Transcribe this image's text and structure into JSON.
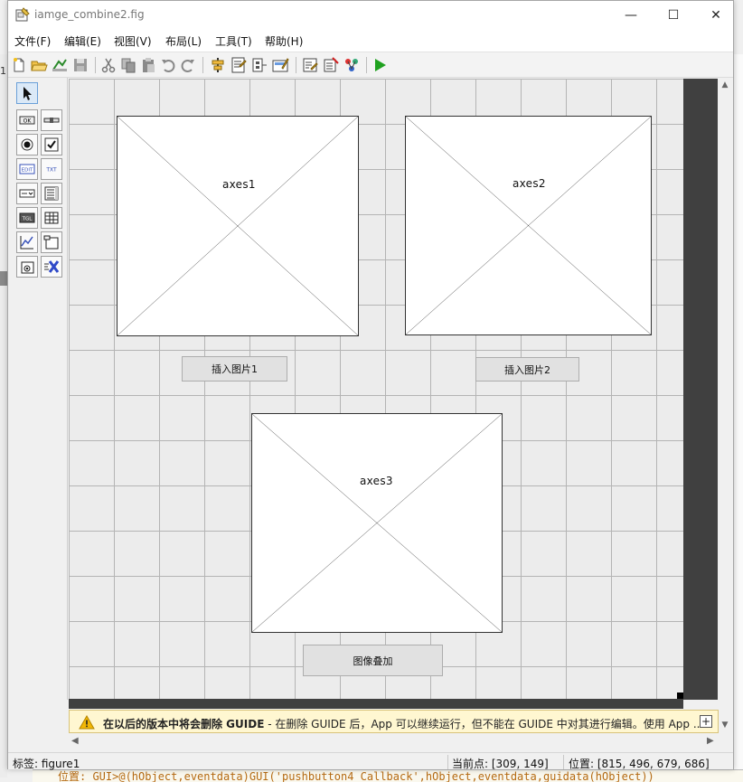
{
  "window": {
    "title": "iamge_combine2.fig",
    "minimize_symbol": "—",
    "maximize_symbol": "☐",
    "close_symbol": "✕"
  },
  "menu": [
    {
      "label": "文件(F)"
    },
    {
      "label": "编辑(E)"
    },
    {
      "label": "视图(V)"
    },
    {
      "label": "布局(L)"
    },
    {
      "label": "工具(T)"
    },
    {
      "label": "帮助(H)"
    }
  ],
  "toolbar": {
    "icons": [
      "new-figure-icon",
      "open-icon",
      "export-icon",
      "save-icon",
      "cut-icon",
      "copy-icon",
      "paste-icon",
      "undo-icon",
      "redo-icon",
      "align-icon",
      "menu-editor-icon",
      "tab-order-icon",
      "toolbar-editor-icon",
      "editor-icon",
      "property-inspector-icon",
      "object-browser-icon",
      "run-icon"
    ],
    "accent_run": "#1fa11f"
  },
  "palette": {
    "items": [
      {
        "name": "select-tool",
        "icon": "arrow-cursor-icon",
        "text": ""
      },
      {
        "name": "pushbutton-tool",
        "icon": "pushbutton-icon",
        "text": "OK"
      },
      {
        "name": "slider-tool",
        "icon": "slider-icon",
        "text": ""
      },
      {
        "name": "radiobutton-tool",
        "icon": "radiobutton-icon",
        "text": ""
      },
      {
        "name": "checkbox-tool",
        "icon": "checkbox-icon",
        "text": ""
      },
      {
        "name": "edit-text-tool",
        "icon": "edit-text-icon",
        "text": "EDIT"
      },
      {
        "name": "static-text-tool",
        "icon": "static-text-icon",
        "text": "TXT"
      },
      {
        "name": "popup-menu-tool",
        "icon": "popup-menu-icon",
        "text": ""
      },
      {
        "name": "listbox-tool",
        "icon": "listbox-icon",
        "text": ""
      },
      {
        "name": "toggle-button-tool",
        "icon": "toggle-button-icon",
        "text": "TGL"
      },
      {
        "name": "table-tool",
        "icon": "table-icon",
        "text": ""
      },
      {
        "name": "axes-tool",
        "icon": "axes-icon",
        "text": ""
      },
      {
        "name": "panel-tool",
        "icon": "panel-icon",
        "text": ""
      },
      {
        "name": "button-group-tool",
        "icon": "button-group-icon",
        "text": ""
      },
      {
        "name": "activex-tool",
        "icon": "activex-icon",
        "text": ""
      }
    ]
  },
  "canvas": {
    "grid_color": "#b4b4b4",
    "background": "#ececec",
    "figure_edge_color": "#404040",
    "axes": [
      {
        "label": "axes1"
      },
      {
        "label": "axes2"
      },
      {
        "label": "axes3"
      }
    ],
    "buttons": [
      {
        "label": "插入图片1"
      },
      {
        "label": "插入图片2"
      },
      {
        "label": "图像叠加"
      }
    ]
  },
  "banner": {
    "icon": "warning-icon",
    "bold_text": "在以后的版本中将会删除 GUIDE",
    "rest_text": " - 在删除 GUIDE 后，App 可以继续运行，但不能在 GUIDE 中对其进行编辑。使用 App ...",
    "expand_symbol": "+",
    "background": "#fff7d1"
  },
  "status": {
    "tag": "标签: figure1",
    "current_point": "当前点:  [309, 149]",
    "position": "位置: [815, 496, 679, 686]"
  },
  "background_env": {
    "left_text": "1.",
    "bottom_code": "位置: GUI>@(hObject,eventdata)GUI('pushbutton4_Callback',hObject,eventdata,guidata(hObject))"
  }
}
